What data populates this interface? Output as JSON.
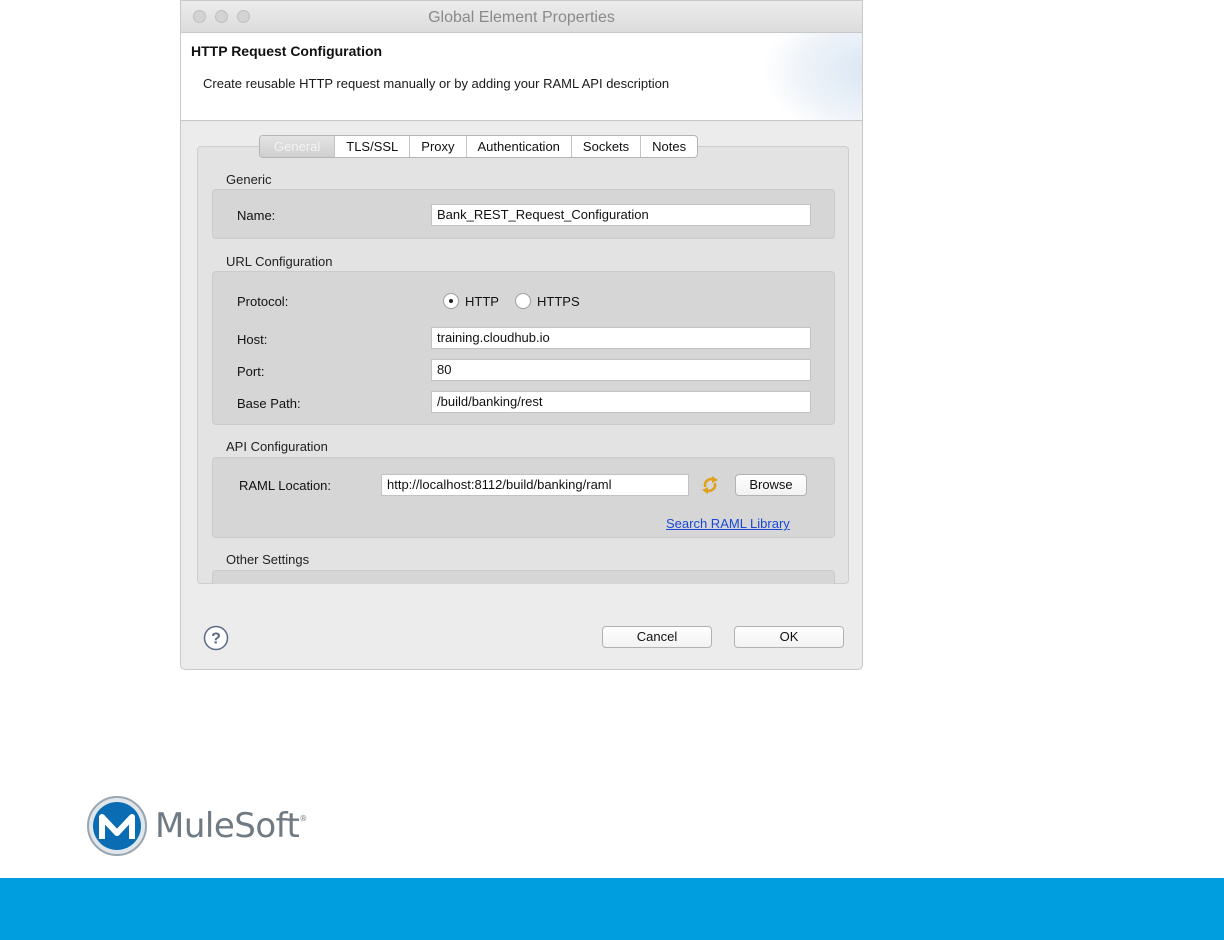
{
  "window": {
    "title": "Global Element Properties"
  },
  "header": {
    "title": "HTTP Request Configuration",
    "description": "Create reusable HTTP request manually or by adding your RAML API description"
  },
  "tabs": [
    {
      "label": "General",
      "active": true
    },
    {
      "label": "TLS/SSL",
      "active": false
    },
    {
      "label": "Proxy",
      "active": false
    },
    {
      "label": "Authentication",
      "active": false
    },
    {
      "label": "Sockets",
      "active": false
    },
    {
      "label": "Notes",
      "active": false
    }
  ],
  "generic": {
    "section_label": "Generic",
    "name_label": "Name:",
    "name_value": "Bank_REST_Request_Configuration"
  },
  "url_config": {
    "section_label": "URL Configuration",
    "protocol_label": "Protocol:",
    "protocol_options": [
      "HTTP",
      "HTTPS"
    ],
    "protocol_selected": "HTTP",
    "host_label": "Host:",
    "host_value": "training.cloudhub.io",
    "port_label": "Port:",
    "port_value": "80",
    "base_path_label": "Base Path:",
    "base_path_value": "/build/banking/rest"
  },
  "api_config": {
    "section_label": "API Configuration",
    "raml_label": "RAML Location:",
    "raml_value": "http://localhost:8112/build/banking/raml",
    "browse_label": "Browse",
    "refresh_icon": "refresh-icon",
    "search_link": "Search RAML Library"
  },
  "other_settings": {
    "section_label": "Other Settings"
  },
  "footer_buttons": {
    "cancel_label": "Cancel",
    "ok_label": "OK",
    "help_icon": "help-icon"
  },
  "brand": {
    "name": "MuleSoft",
    "logo_icon": "mulesoft-logo",
    "bar_color": "#009ddf"
  }
}
